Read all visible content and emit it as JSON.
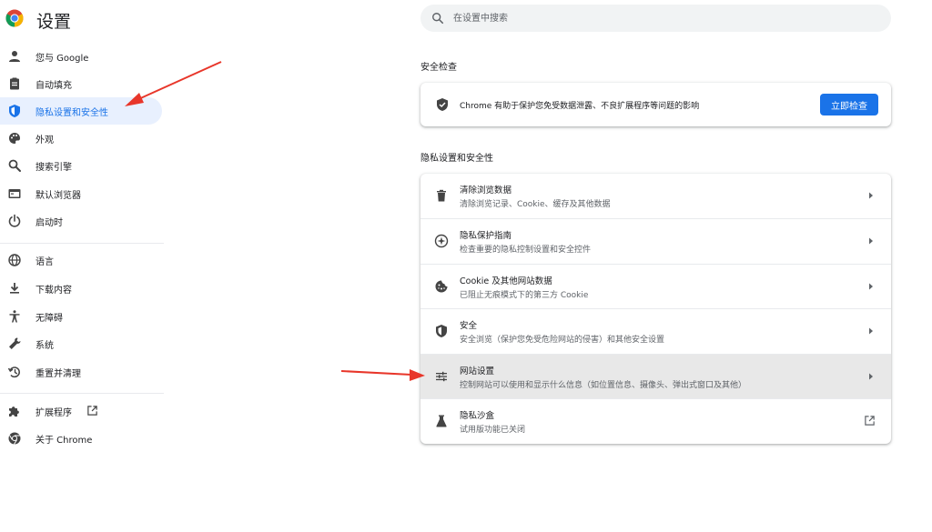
{
  "header": {
    "title": "设置",
    "search_placeholder": "在设置中搜索"
  },
  "sidebar": {
    "items": [
      {
        "label": "您与 Google",
        "icon": "person-icon"
      },
      {
        "label": "自动填充",
        "icon": "clipboard-icon"
      },
      {
        "label": "隐私设置和安全性",
        "icon": "shield-icon",
        "active": true
      },
      {
        "label": "外观",
        "icon": "palette-icon"
      },
      {
        "label": "搜索引擎",
        "icon": "search-icon"
      },
      {
        "label": "默认浏览器",
        "icon": "browser-icon"
      },
      {
        "label": "启动时",
        "icon": "power-icon"
      },
      {
        "label": "语言",
        "icon": "globe-icon"
      },
      {
        "label": "下载内容",
        "icon": "download-icon"
      },
      {
        "label": "无障碍",
        "icon": "accessibility-icon"
      },
      {
        "label": "系统",
        "icon": "wrench-icon"
      },
      {
        "label": "重置并清理",
        "icon": "restore-icon"
      },
      {
        "label": "扩展程序",
        "icon": "puzzle-icon"
      },
      {
        "label": "关于 Chrome",
        "icon": "chrome-icon"
      }
    ]
  },
  "safety_check": {
    "section_title": "安全检查",
    "description": "Chrome 有助于保护您免受数据泄露、不良扩展程序等问题的影响",
    "button_label": "立即检查"
  },
  "privacy": {
    "section_title": "隐私设置和安全性",
    "rows": [
      {
        "title": "清除浏览数据",
        "subtitle": "清除浏览记录、Cookie、缓存及其他数据",
        "icon": "trash-icon"
      },
      {
        "title": "隐私保护指南",
        "subtitle": "检查重要的隐私控制设置和安全控件",
        "icon": "compass-icon"
      },
      {
        "title": "Cookie 及其他网站数据",
        "subtitle": "已阻止无痕模式下的第三方 Cookie",
        "icon": "cookie-icon"
      },
      {
        "title": "安全",
        "subtitle": "安全浏览（保护您免受危险网站的侵害）和其他安全设置",
        "icon": "security-shield-icon"
      },
      {
        "title": "网站设置",
        "subtitle": "控制网站可以使用和显示什么信息（如位置信息、摄像头、弹出式窗口及其他）",
        "icon": "tune-icon",
        "highlighted": true
      },
      {
        "title": "隐私沙盒",
        "subtitle": "试用版功能已关闭",
        "icon": "flask-icon"
      }
    ]
  },
  "colors": {
    "accent": "#1a73e8",
    "active_bg": "#e8f0fe",
    "highlight_bg": "#e8e8e8",
    "annotation_arrow": "#e8362a"
  }
}
